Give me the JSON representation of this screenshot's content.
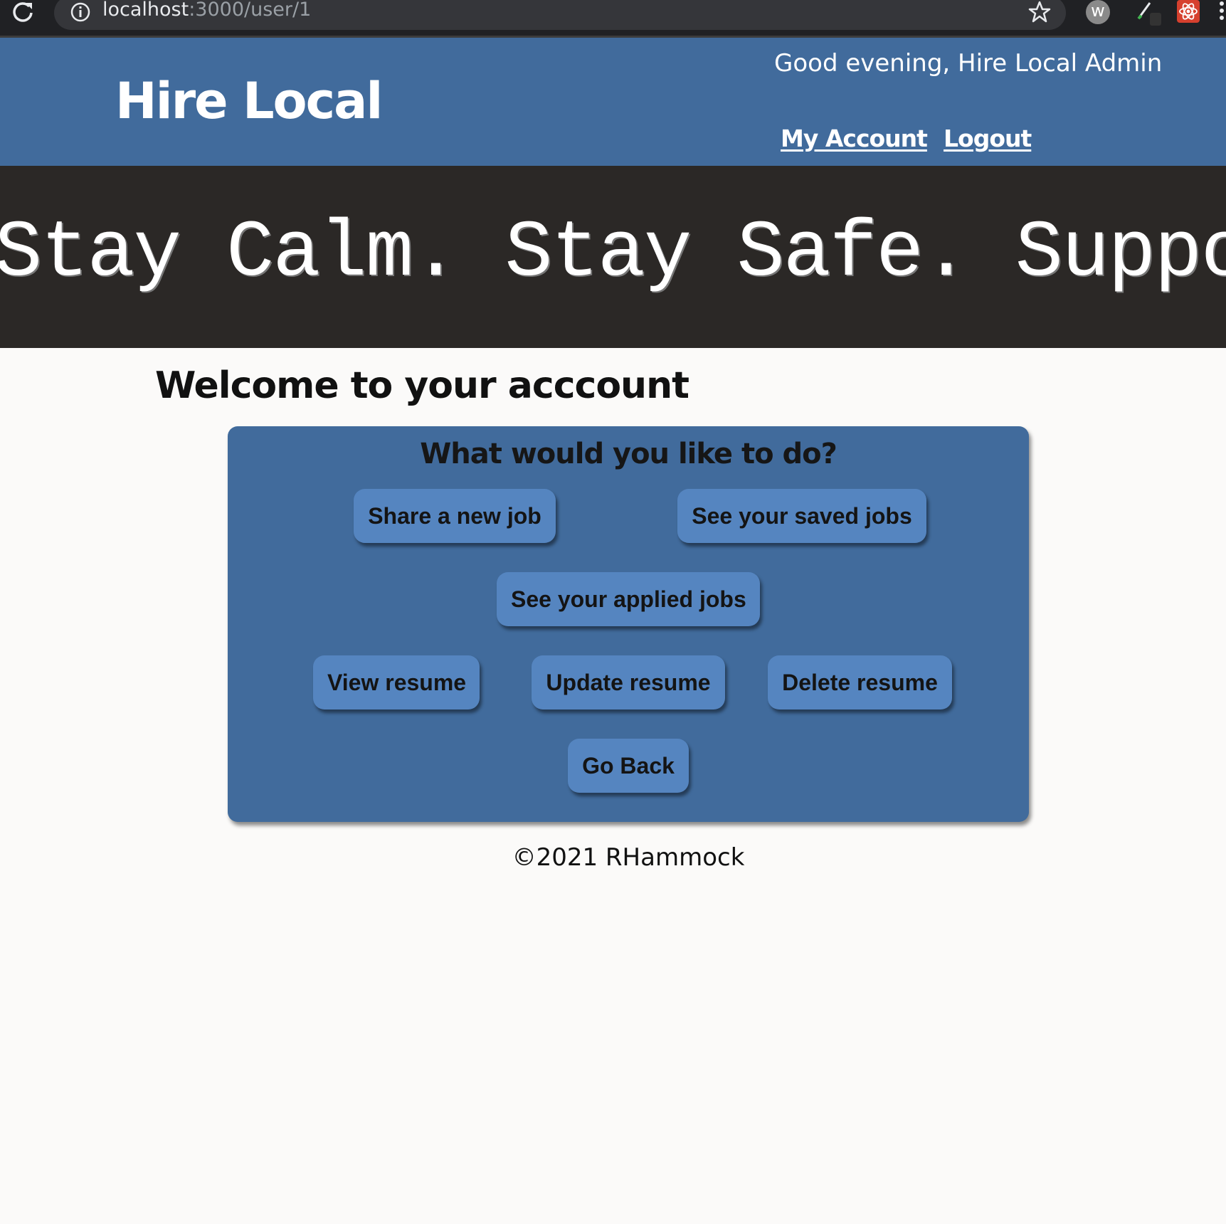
{
  "browser": {
    "url_host": "localhost",
    "url_path": ":3000/user/1"
  },
  "header": {
    "brand": "Hire Local",
    "greeting": "Good evening, Hire Local Admin",
    "nav": {
      "my_account": "My Account",
      "logout": "Logout"
    }
  },
  "banner": {
    "text": "Stay Calm. Stay Safe. Support Local"
  },
  "main": {
    "welcome": "Welcome to your acccount",
    "card": {
      "heading": "What would you like to do?",
      "buttons": {
        "share_job": "Share a new job",
        "saved_jobs": "See your saved jobs",
        "applied_jobs": "See your applied jobs",
        "view_resume": "View resume",
        "update_resume": "Update resume",
        "delete_resume": "Delete resume",
        "go_back": "Go Back"
      }
    }
  },
  "footer": {
    "text": "©2021 RHammock"
  },
  "colors": {
    "header_bg": "#416b9c",
    "banner_bg": "#2b2826",
    "button_bg": "#5585c0",
    "page_bg": "#fbfaf9"
  }
}
